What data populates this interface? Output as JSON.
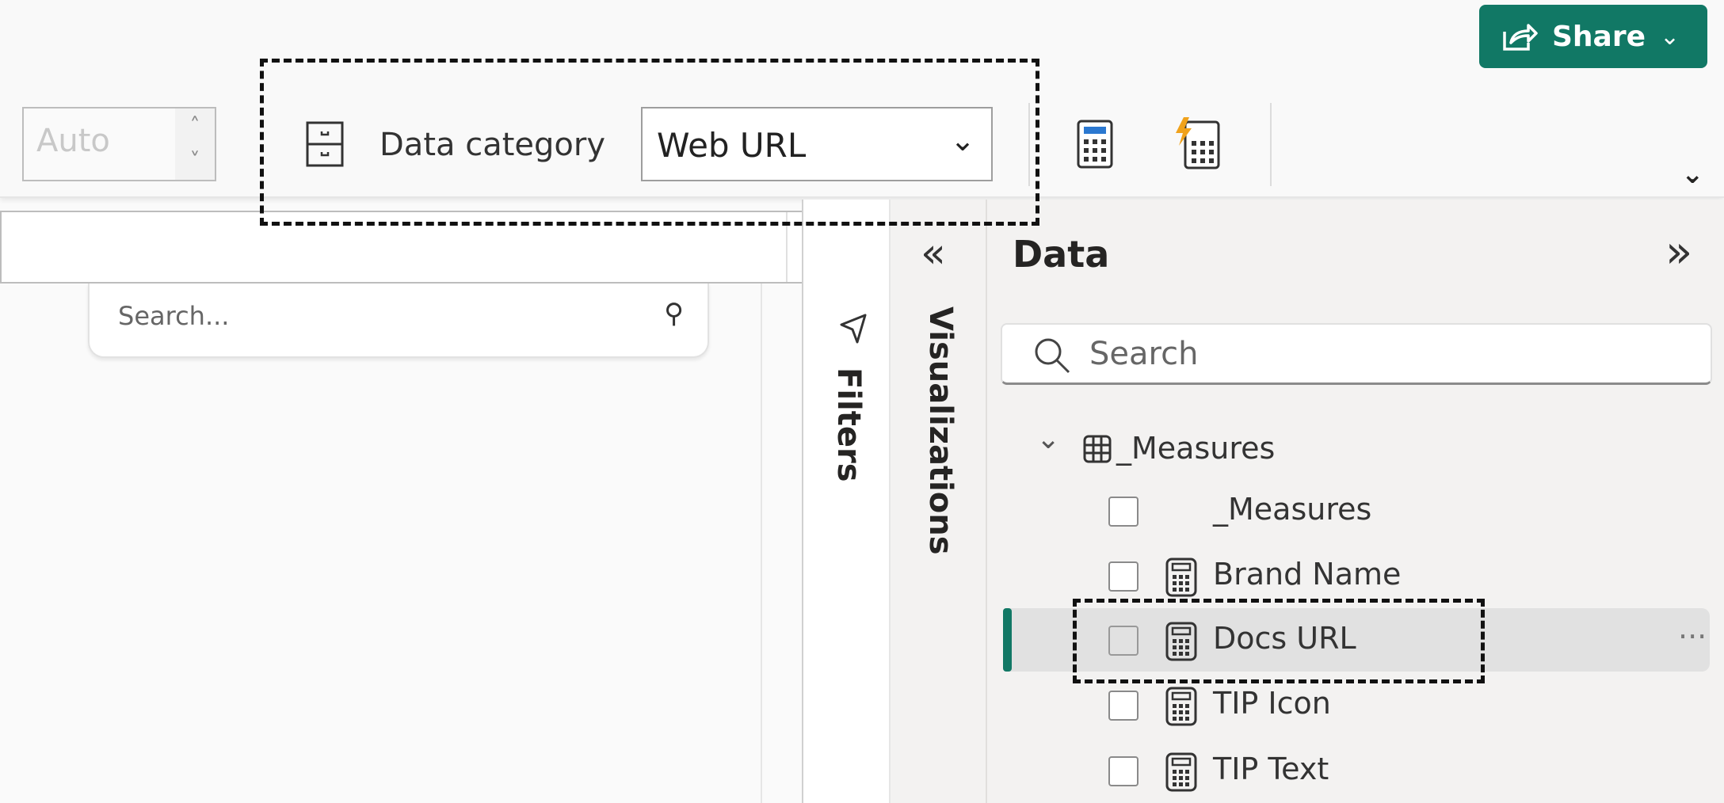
{
  "header": {
    "share_label": "Share",
    "share_icon": "share-icon",
    "share_color": "#117865"
  },
  "ribbon": {
    "format_value": "Auto",
    "data_category_label": "Data category",
    "data_category_value": "Web URL",
    "new_measure_icon": "calculator-icon",
    "quick_measure_icon": "quick-measure-icon"
  },
  "left": {
    "search_placeholder": "Search..."
  },
  "panes": {
    "filters": "Filters",
    "visualizations": "Visualizations"
  },
  "data": {
    "title": "Data",
    "search_placeholder": "Search",
    "table": "_Measures",
    "fields": [
      {
        "label": "_Measures",
        "icon": ""
      },
      {
        "label": "Brand Name",
        "icon": "calculator-icon"
      },
      {
        "label": "Docs URL",
        "icon": "calculator-icon",
        "selected": true
      },
      {
        "label": "TIP Icon",
        "icon": "calculator-icon"
      },
      {
        "label": "TIP Text",
        "icon": "calculator-icon"
      }
    ],
    "more": "···"
  }
}
